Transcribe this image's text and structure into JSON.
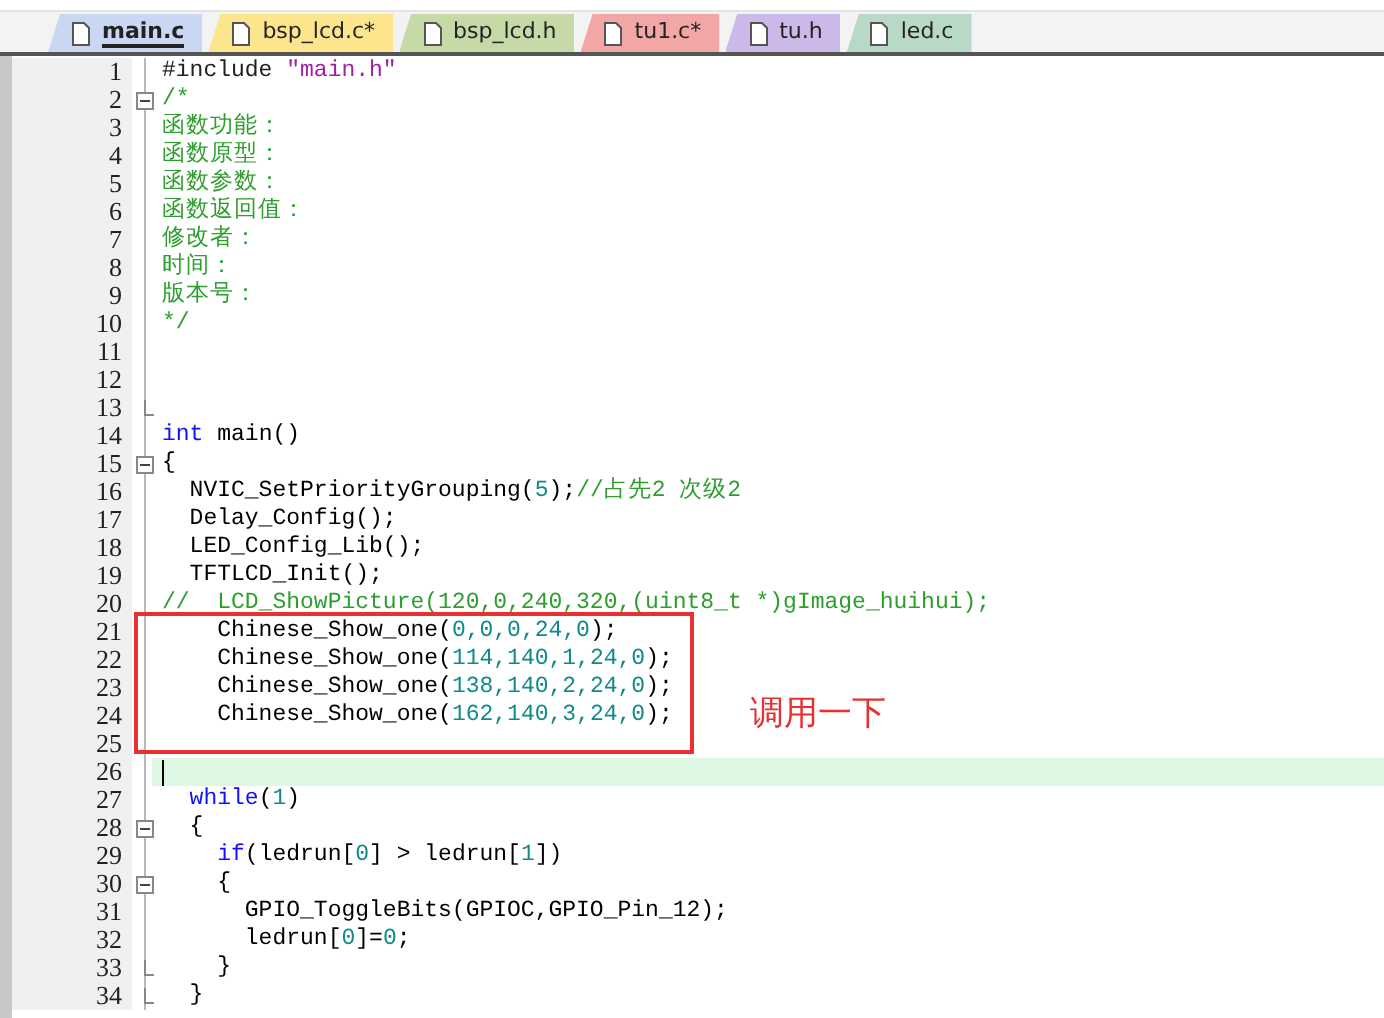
{
  "tabs": [
    {
      "label": "main.c",
      "selected": true,
      "color": "#c9d7f2"
    },
    {
      "label": "bsp_lcd.c*",
      "selected": false,
      "color": "#fde58e"
    },
    {
      "label": "bsp_lcd.h",
      "selected": false,
      "color": "#c6daa8"
    },
    {
      "label": "tu1.c*",
      "selected": false,
      "color": "#f2a6a6"
    },
    {
      "label": "tu.h",
      "selected": false,
      "color": "#cdb8ea"
    },
    {
      "label": "led.c",
      "selected": false,
      "color": "#b8d9c6"
    }
  ],
  "editor": {
    "lines": [
      {
        "number": "1",
        "current": false,
        "kind": "code",
        "segments": [
          {
            "kind": "preproc",
            "text": "#include "
          },
          {
            "kind": "string",
            "text": "\"main.h\""
          }
        ]
      },
      {
        "number": "2",
        "current": false,
        "kind": "foldstart",
        "segments": [
          {
            "kind": "comment",
            "text": "/*"
          }
        ]
      },
      {
        "number": "3",
        "current": false,
        "kind": "code",
        "segments": [
          {
            "kind": "comment",
            "text": "函数功能："
          }
        ]
      },
      {
        "number": "4",
        "current": false,
        "kind": "code",
        "segments": [
          {
            "kind": "comment",
            "text": "函数原型："
          }
        ]
      },
      {
        "number": "5",
        "current": false,
        "kind": "code",
        "segments": [
          {
            "kind": "comment",
            "text": "函数参数："
          }
        ]
      },
      {
        "number": "6",
        "current": false,
        "kind": "code",
        "segments": [
          {
            "kind": "comment",
            "text": "函数返回值："
          }
        ]
      },
      {
        "number": "7",
        "current": false,
        "kind": "code",
        "segments": [
          {
            "kind": "comment",
            "text": "修改者："
          }
        ]
      },
      {
        "number": "8",
        "current": false,
        "kind": "code",
        "segments": [
          {
            "kind": "comment",
            "text": "时间："
          }
        ]
      },
      {
        "number": "9",
        "current": false,
        "kind": "code",
        "segments": [
          {
            "kind": "comment",
            "text": "版本号："
          }
        ]
      },
      {
        "number": "10",
        "current": false,
        "kind": "code",
        "segments": [
          {
            "kind": "comment",
            "text": "*/"
          }
        ]
      },
      {
        "number": "11",
        "current": false,
        "kind": "code"
      },
      {
        "number": "12",
        "current": false,
        "kind": "code"
      },
      {
        "number": "13",
        "current": false,
        "kind": "foldend"
      },
      {
        "number": "14",
        "current": false,
        "kind": "code",
        "segments": [
          {
            "kind": "keyword",
            "text": "int"
          },
          {
            "kind": "plain",
            "text": " main()"
          }
        ]
      },
      {
        "number": "15",
        "current": false,
        "kind": "foldstart",
        "segments": [
          {
            "kind": "plain",
            "text": "{"
          }
        ]
      },
      {
        "number": "16",
        "current": false,
        "kind": "code",
        "segments": [
          {
            "kind": "plain",
            "text": "  NVIC_SetPriorityGrouping("
          },
          {
            "kind": "number",
            "text": "5"
          },
          {
            "kind": "plain",
            "text": ");"
          },
          {
            "kind": "comment",
            "text": "//占先2 次级2"
          }
        ]
      },
      {
        "number": "17",
        "current": false,
        "kind": "code",
        "segments": [
          {
            "kind": "plain",
            "text": "  Delay_Config();"
          }
        ]
      },
      {
        "number": "18",
        "current": false,
        "kind": "code",
        "segments": [
          {
            "kind": "plain",
            "text": "  LED_Config_Lib();"
          }
        ]
      },
      {
        "number": "19",
        "current": false,
        "kind": "code",
        "segments": [
          {
            "kind": "plain",
            "text": "  TFTLCD_Init();"
          }
        ]
      },
      {
        "number": "20",
        "current": false,
        "kind": "code",
        "segments": [
          {
            "kind": "comment",
            "text": "//  LCD_ShowPicture(120,0,240,320,(uint8_t *)gImage_huihui);"
          }
        ]
      },
      {
        "number": "21",
        "current": false,
        "kind": "code",
        "segments": [
          {
            "kind": "plain",
            "text": "    Chinese_Show_one("
          },
          {
            "kind": "number",
            "text": "0,0,0,24,0"
          },
          {
            "kind": "plain",
            "text": ");"
          }
        ]
      },
      {
        "number": "22",
        "current": false,
        "kind": "code",
        "segments": [
          {
            "kind": "plain",
            "text": "    Chinese_Show_one("
          },
          {
            "kind": "number",
            "text": "114,140,1,24,0"
          },
          {
            "kind": "plain",
            "text": ");"
          }
        ]
      },
      {
        "number": "23",
        "current": false,
        "kind": "code",
        "segments": [
          {
            "kind": "plain",
            "text": "    Chinese_Show_one("
          },
          {
            "kind": "number",
            "text": "138,140,2,24,0"
          },
          {
            "kind": "plain",
            "text": ");"
          }
        ]
      },
      {
        "number": "24",
        "current": false,
        "kind": "code",
        "segments": [
          {
            "kind": "plain",
            "text": "    Chinese_Show_one("
          },
          {
            "kind": "number",
            "text": "162,140,3,24,0"
          },
          {
            "kind": "plain",
            "text": ");"
          }
        ]
      },
      {
        "number": "25",
        "current": false,
        "kind": "code"
      },
      {
        "number": "26",
        "current": true,
        "kind": "code"
      },
      {
        "number": "27",
        "current": false,
        "kind": "code",
        "segments": [
          {
            "kind": "keyword",
            "text": "  while"
          },
          {
            "kind": "plain",
            "text": "("
          },
          {
            "kind": "number",
            "text": "1"
          },
          {
            "kind": "plain",
            "text": ")"
          }
        ]
      },
      {
        "number": "28",
        "current": false,
        "kind": "foldstart",
        "segments": [
          {
            "kind": "plain",
            "text": "  {"
          }
        ]
      },
      {
        "number": "29",
        "current": false,
        "kind": "code",
        "segments": [
          {
            "kind": "keyword",
            "text": "    if"
          },
          {
            "kind": "plain",
            "text": "(ledrun["
          },
          {
            "kind": "number",
            "text": "0"
          },
          {
            "kind": "plain",
            "text": "] > ledrun["
          },
          {
            "kind": "number",
            "text": "1"
          },
          {
            "kind": "plain",
            "text": "])"
          }
        ]
      },
      {
        "number": "30",
        "current": false,
        "kind": "foldstart",
        "segments": [
          {
            "kind": "plain",
            "text": "    {"
          }
        ]
      },
      {
        "number": "31",
        "current": false,
        "kind": "code",
        "segments": [
          {
            "kind": "plain",
            "text": "      GPIO_ToggleBits(GPIOC,GPIO_Pin_12);"
          }
        ]
      },
      {
        "number": "32",
        "current": false,
        "kind": "code",
        "segments": [
          {
            "kind": "plain",
            "text": "      ledrun["
          },
          {
            "kind": "number",
            "text": "0"
          },
          {
            "kind": "plain",
            "text": "]="
          },
          {
            "kind": "number",
            "text": "0"
          },
          {
            "kind": "plain",
            "text": ";"
          }
        ]
      },
      {
        "number": "33",
        "current": false,
        "kind": "foldend",
        "segments": [
          {
            "kind": "plain",
            "text": "    }"
          }
        ]
      },
      {
        "number": "34",
        "current": false,
        "kind": "foldend",
        "segments": [
          {
            "kind": "plain",
            "text": "  }"
          }
        ]
      }
    ]
  },
  "annotation": {
    "text": "调用一下"
  }
}
